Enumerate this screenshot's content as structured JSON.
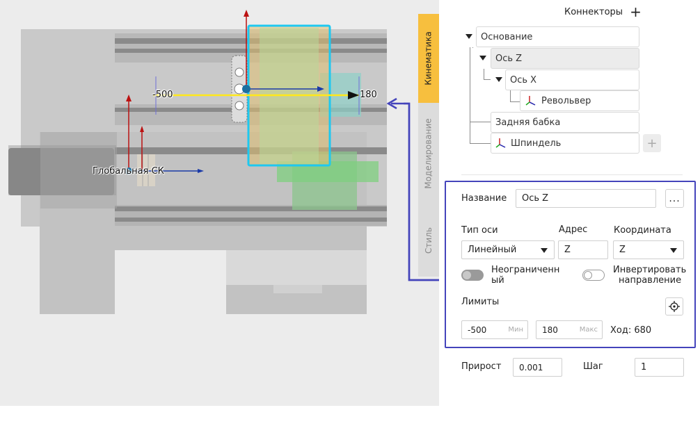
{
  "viewport": {
    "axis_min_label": "-500",
    "axis_max_label": "180",
    "global_cs_label": "Глобальная СК",
    "colors": {
      "axis_line": "#ffe81a",
      "selection": "#1ec8f0",
      "callout": "#4444bb"
    }
  },
  "side_tabs": [
    {
      "label": "Кинематика",
      "active": true
    },
    {
      "label": "Моделирование",
      "active": false
    },
    {
      "label": "Стиль",
      "active": false
    }
  ],
  "connectors": {
    "title": "Коннекторы",
    "add_icon": "plus-icon",
    "tree": [
      {
        "label": "Основание",
        "level": 0,
        "expanded": true,
        "selected": false,
        "icon": null
      },
      {
        "label": "Ось Z",
        "level": 1,
        "expanded": true,
        "selected": true,
        "icon": null
      },
      {
        "label": "Ось X",
        "level": 2,
        "expanded": true,
        "selected": false,
        "icon": null
      },
      {
        "label": "Револьвер",
        "level": 3,
        "expanded": false,
        "selected": false,
        "icon": "axes-icon"
      },
      {
        "label": "Задняя бабка",
        "level": 1,
        "expanded": false,
        "selected": false,
        "icon": null
      },
      {
        "label": "Шпиндель",
        "level": 1,
        "expanded": false,
        "selected": false,
        "icon": "axes-icon"
      }
    ],
    "add_button": "+"
  },
  "properties": {
    "name_label": "Название",
    "name_value": "Ось Z",
    "more_button": "...",
    "axis_type_label": "Тип оси",
    "axis_type_value": "Линейный",
    "address_label": "Адрес",
    "address_value": "Z",
    "coordinate_label": "Координата",
    "coordinate_value": "Z",
    "unlimited_label_1": "Неограниченн",
    "unlimited_label_2": "ый",
    "unlimited_on": false,
    "invert_label_1": "Инвертировать",
    "invert_label_2": "направление",
    "invert_on": false,
    "limits_label": "Лимиты",
    "min_value": "-500",
    "min_hint": "Мин",
    "max_value": "180",
    "max_hint": "Макс",
    "travel_text": "Ход: 680"
  },
  "footer": {
    "increment_label": "Прирост",
    "increment_value": "0.001",
    "step_label": "Шаг",
    "step_value": "1"
  }
}
